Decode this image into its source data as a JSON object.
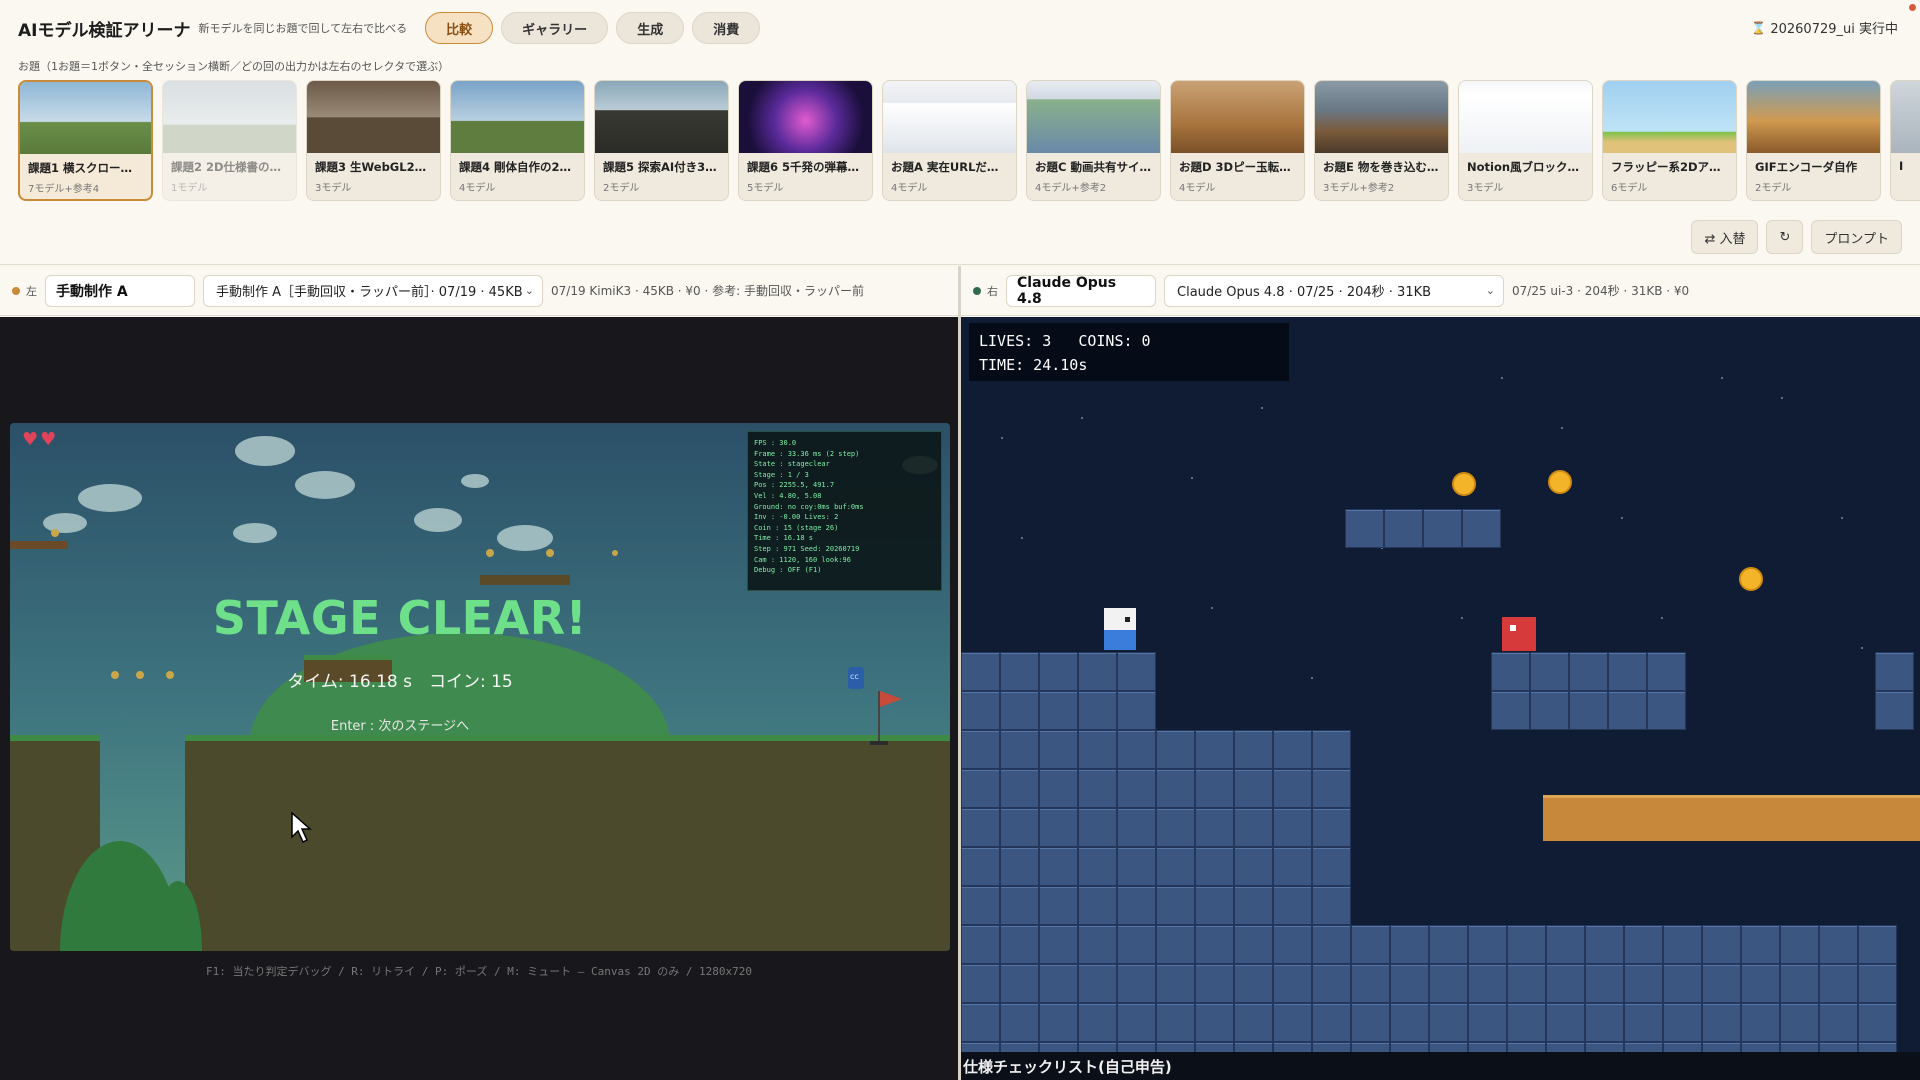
{
  "app": {
    "title": "AIモデル検証アリーナ",
    "subtitle": "新モデルを同じお題で回して左右で比べる",
    "status": "20260729_ui 実行中",
    "status_icon": "hourglass-icon"
  },
  "nav": {
    "tabs": [
      {
        "label": "比較",
        "active": true
      },
      {
        "label": "ギャラリー",
        "active": false
      },
      {
        "label": "生成",
        "active": false
      },
      {
        "label": "消費",
        "active": false
      }
    ]
  },
  "topics": {
    "label": "お題（1お題＝1ボタン・全セッション横断／どの回の出力かは左右のセレクタで選ぶ）",
    "cards": [
      {
        "title": "課題1 横スクロール…",
        "count": "7モデル+参考4",
        "active": true,
        "dim": false
      },
      {
        "title": "課題2 2D仕様書の…",
        "count": "1モデル",
        "active": false,
        "dim": true
      },
      {
        "title": "課題3 生WebGL2…",
        "count": "3モデル",
        "active": false,
        "dim": false
      },
      {
        "title": "課題4 剛体自作の2…",
        "count": "4モデル",
        "active": false,
        "dim": false
      },
      {
        "title": "課題5 探索AI付き3…",
        "count": "2モデル",
        "active": false,
        "dim": false
      },
      {
        "title": "課題6 5千発の弾幕…",
        "count": "5モデル",
        "active": false,
        "dim": false
      },
      {
        "title": "お題A 実在URLだ…",
        "count": "4モデル",
        "active": false,
        "dim": false
      },
      {
        "title": "お題C 動画共有サイ…",
        "count": "4モデル+参考2",
        "active": false,
        "dim": false
      },
      {
        "title": "お題D 3Dピー玉転…",
        "count": "4モデル",
        "active": false,
        "dim": false
      },
      {
        "title": "お題E 物を巻き込む…",
        "count": "3モデル+参考2",
        "active": false,
        "dim": false
      },
      {
        "title": "Notion風ブロック…",
        "count": "3モデル",
        "active": false,
        "dim": false
      },
      {
        "title": "フラッピー系2Dア…",
        "count": "6モデル",
        "active": false,
        "dim": false
      },
      {
        "title": "GIFエンコーダ自作",
        "count": "2モデル",
        "active": false,
        "dim": false
      },
      {
        "title": "I",
        "count": "",
        "active": false,
        "dim": false
      }
    ]
  },
  "actions": {
    "swap": "⇄ 入替",
    "reload": "↻",
    "prompt": "プロンプト"
  },
  "left": {
    "side": "左",
    "name": "手動制作 A",
    "select": "手動制作 A［手動回収・ラッパー前］· 07/19 · 45KB",
    "meta": "07/19 KimiK3 · 45KB · ¥0 · 参考: 手動回収・ラッパー前",
    "dot_color": "#c98a3a",
    "game": {
      "hearts": "♥♥",
      "title": "STAGE CLEAR!",
      "result": "タイム: 16.18 s　コイン: 15",
      "next": "Enter : 次のステージへ",
      "debug": [
        "FPS   : 30.0",
        "Frame : 33.36 ms (2 step)",
        "State : stageclear",
        "Stage : 1 / 3",
        "Pos   : 2255.5, 491.7",
        "Vel   : 4.80, 5.08",
        "Ground: no  coy:0ms buf:0ms",
        "Inv   : -0.00  Lives: 2",
        "Coin  : 15 (stage 26)",
        "Time  : 16.18 s",
        "Step  : 971  Seed: 20260719",
        "Cam   : 1120, 160  look:96",
        "Debug : OFF (F1)"
      ],
      "hint": "F1: 当たり判定デバッグ / R: リトライ / P: ポーズ / M: ミュート — Canvas 2D のみ / 1280x720"
    }
  },
  "right": {
    "side": "右",
    "name": "Claude Opus 4.8",
    "select": "Claude Opus 4.8 · 07/25 · 204秒 · 31KB",
    "meta": "07/25 ui-3 · 204秒 · 31KB · ¥0",
    "dot_color": "#2f6b4f",
    "game": {
      "hud_line1": "LIVES: 3   COINS: 0",
      "hud_line2": "TIME: 24.10s",
      "checklist": "仕様チェックリスト(自己申告)"
    }
  }
}
